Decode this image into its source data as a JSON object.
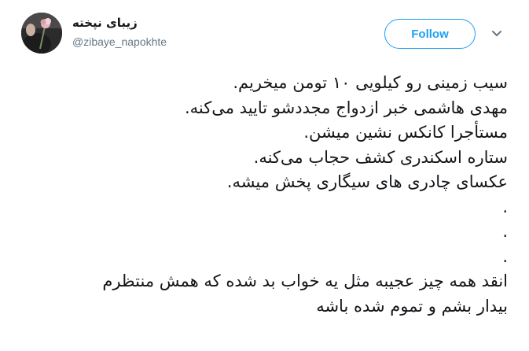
{
  "user": {
    "display_name": "زیبای نپخته",
    "handle": "@zibaye_napokhte",
    "avatar_icon": "avatar-photo-flower"
  },
  "actions": {
    "follow_label": "Follow",
    "more_icon": "chevron-down-icon"
  },
  "colors": {
    "accent": "#1da1f2",
    "text": "#14171a",
    "secondary_text": "#657786"
  },
  "tweet": {
    "lines": [
      "سیب زمینی رو کیلویی ۱۰ تومن میخریم.",
      "مهدی هاشمی خبر ازدواج مجددشو تایید می‌کنه.",
      "مستأجرا کانکس نشین میشن.",
      "ستاره اسکندری کشف حجاب می‌کنه.",
      "عکسای چادری های سیگاری پخش میشه.",
      ".",
      ".",
      ".",
      "انقد همه چیز  عجیبه مثل یه خواب بد شده که همش منتظرم",
      "بیدار بشم و تموم شده باشه"
    ]
  }
}
